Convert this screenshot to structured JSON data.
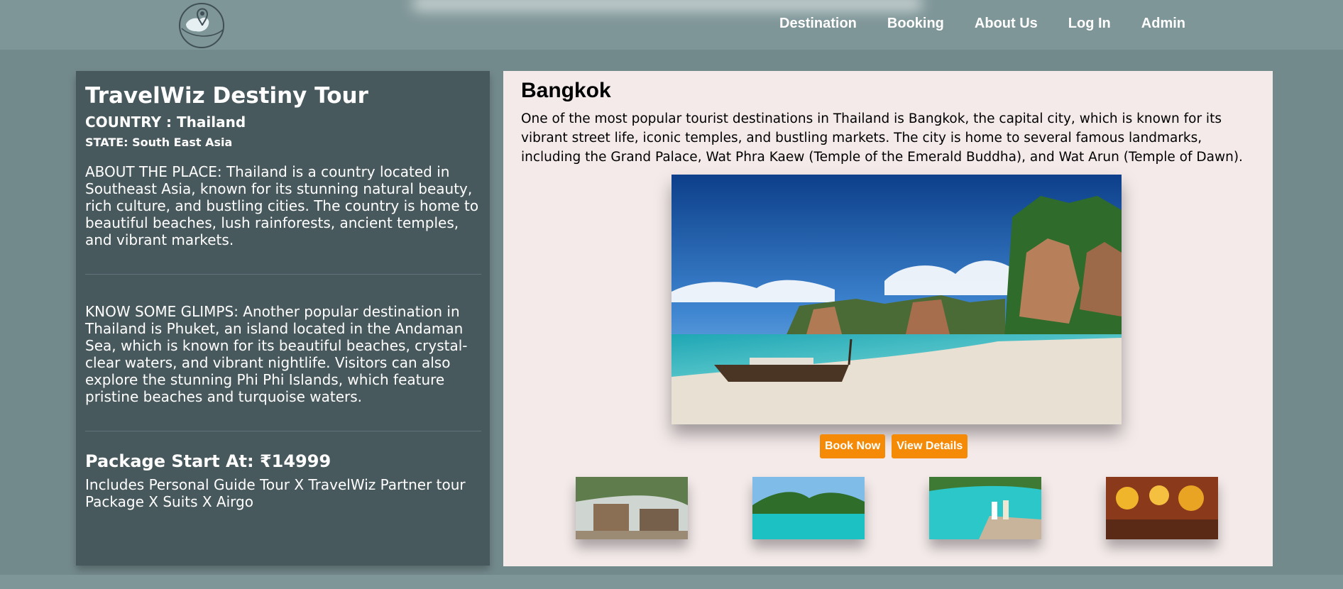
{
  "nav": {
    "items": [
      "Destination",
      "Booking",
      "About Us",
      "Log In",
      "Admin"
    ]
  },
  "info": {
    "title": "TravelWiz Destiny Tour",
    "country": "COUNTRY : Thailand",
    "state": "STATE: South East Asia",
    "about": "ABOUT THE PLACE: Thailand is a country located in Southeast Asia, known for its stunning natural beauty, rich culture, and bustling cities. The country is home to beautiful beaches, lush rainforests, ancient temples, and vibrant markets.",
    "glimps": "KNOW SOME GLIMPS: Another popular destination in Thailand is Phuket, an island located in the Andaman Sea, which is known for its beautiful beaches, crystal-clear waters, and vibrant nightlife. Visitors can also explore the stunning Phi Phi Islands, which feature pristine beaches and turquoise waters.",
    "price": "Package Start At: ₹14999",
    "includes": "Includes Personal Guide Tour X TravelWiz Partner tour Package X Suits X Airgo"
  },
  "destination": {
    "name": "Bangkok",
    "description": "One of the most popular tourist destinations in Thailand is Bangkok, the capital city, which is known for its vibrant street life, iconic temples, and bustling markets. The city is home to several famous landmarks, including the Grand Palace, Wat Phra Kaew (Temple of the Emerald Buddha), and Wat Arun (Temple of Dawn).",
    "book_label": "Book Now",
    "details_label": "View Details"
  },
  "colors": {
    "accent": "#f58a07",
    "panel_dark": "#48595e",
    "panel_light": "#f4eaea",
    "background": "#738a8d"
  }
}
